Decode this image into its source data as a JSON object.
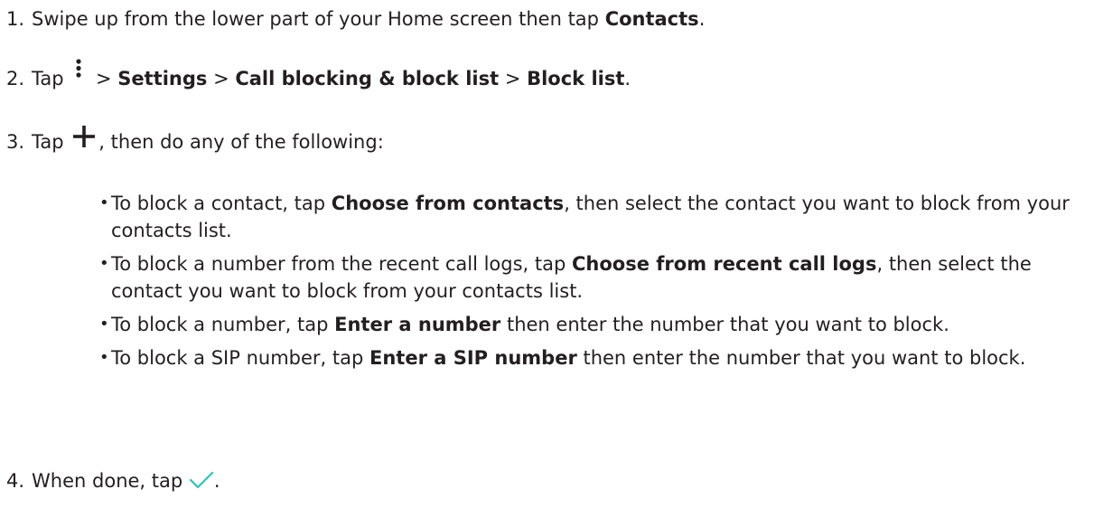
{
  "steps": [
    {
      "number": "1.",
      "parts": [
        "Swipe up from the lower part of your Home screen then tap ",
        "Contacts",
        "."
      ]
    },
    {
      "number": "2.",
      "icon": "more-vert-icon",
      "parts": [
        "Tap",
        "> ",
        "Settings",
        " > ",
        "Call blocking & block list",
        " > ",
        "Block list",
        "."
      ]
    },
    {
      "number": "3.",
      "icon": "plus-icon",
      "parts": [
        "Tap",
        ", then do any of the following:"
      ]
    },
    {
      "number": "4.",
      "icon": "checkmark-icon",
      "parts": [
        "When done, tap",
        "."
      ]
    }
  ],
  "bullets": [
    {
      "text_before": "To block a contact, tap ",
      "bold": "Choose from contacts",
      "text_after": ", then select the contact you want to block from your contacts list."
    },
    {
      "text_before": "To block a number from the recent call logs, tap ",
      "bold": "Choose from recent call logs",
      "text_after": ", then select the contact you want to block from your contacts list."
    },
    {
      "text_before": "To block a number, tap ",
      "bold": "Enter a number",
      "text_after": " then enter the number that you want to block."
    },
    {
      "text_before": "To block a SIP number, tap ",
      "bold": "Enter a SIP number",
      "text_after": " then enter the number that you want to block."
    }
  ],
  "colors": {
    "text": "#231f20",
    "checkmark": "#2ec4b6"
  }
}
